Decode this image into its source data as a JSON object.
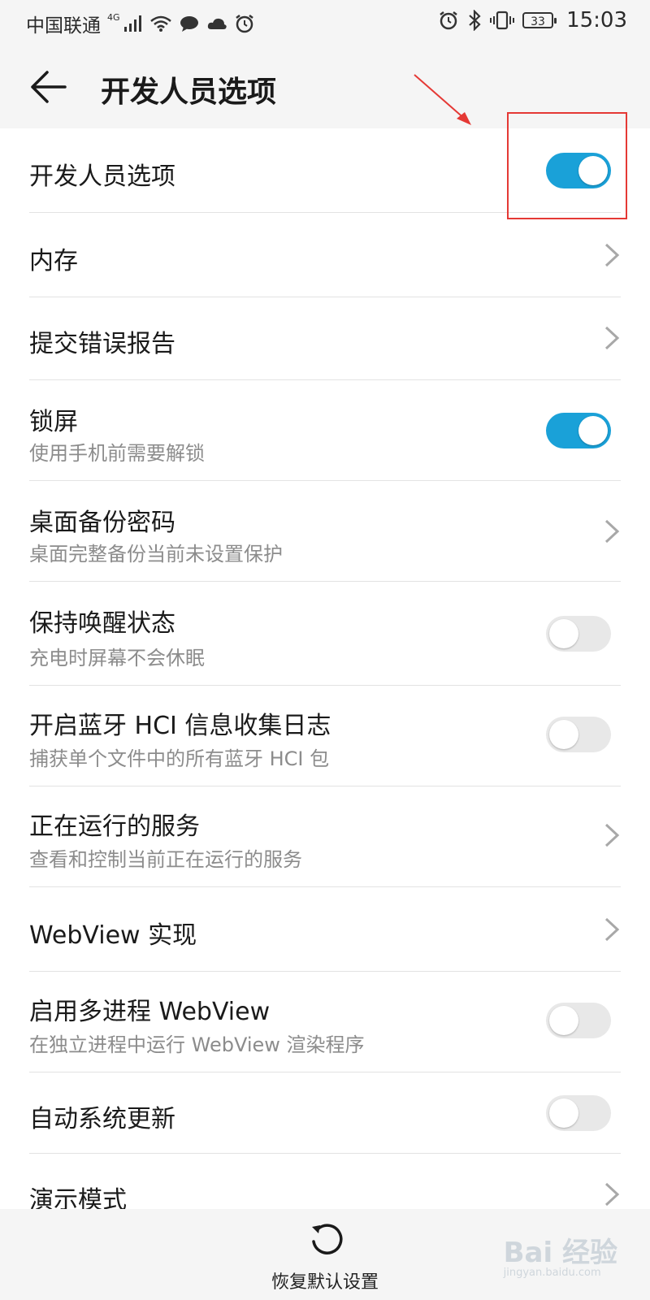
{
  "status_bar": {
    "carrier": "中国联通",
    "network": "4G",
    "battery": "33",
    "time": "15:03"
  },
  "header": {
    "title": "开发人员选项"
  },
  "settings": [
    {
      "title": "开发人员选项",
      "control": "toggle",
      "on": true
    },
    {
      "title": "内存",
      "control": "chevron"
    },
    {
      "title": "提交错误报告",
      "control": "chevron"
    },
    {
      "title": "锁屏",
      "subtitle": "使用手机前需要解锁",
      "control": "toggle",
      "on": true
    },
    {
      "title": "桌面备份密码",
      "subtitle": "桌面完整备份当前未设置保护",
      "control": "chevron"
    },
    {
      "title": "保持唤醒状态",
      "subtitle": "充电时屏幕不会休眠",
      "control": "toggle",
      "on": false
    },
    {
      "title": "开启蓝牙 HCI 信息收集日志",
      "subtitle": "捕获单个文件中的所有蓝牙 HCI 包",
      "control": "toggle",
      "on": false
    },
    {
      "title": "正在运行的服务",
      "subtitle": "查看和控制当前正在运行的服务",
      "control": "chevron"
    },
    {
      "title": "WebView 实现",
      "control": "chevron"
    },
    {
      "title": "启用多进程 WebView",
      "subtitle": "在独立进程中运行 WebView 渲染程序",
      "control": "toggle",
      "on": false
    },
    {
      "title": "自动系统更新",
      "control": "toggle",
      "on": false
    },
    {
      "title": "演示模式",
      "control": "chevron"
    }
  ],
  "bottom_bar": {
    "reset_label": "恢复默认设置"
  },
  "watermark": {
    "brand": "Bai 经验",
    "url": "jingyan.baidu.com"
  },
  "colors": {
    "toggle_on": "#1aa1d8",
    "toggle_off": "#e8e8e8",
    "annotation": "#e53935"
  }
}
